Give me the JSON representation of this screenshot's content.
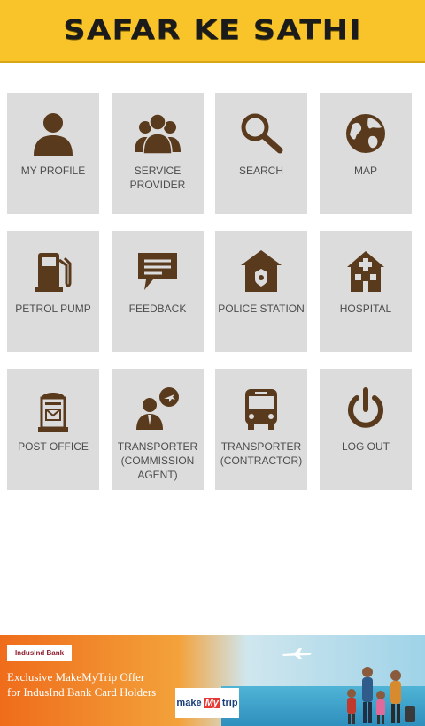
{
  "header": {
    "title": "SAFAR KE SATHI"
  },
  "colors": {
    "header_bg": "#f9c32a",
    "tile_bg": "#dcdcdc",
    "icon": "#5a3a1c",
    "label": "#4d4d4d"
  },
  "menu": [
    {
      "label": "MY PROFILE",
      "icon": "person-icon"
    },
    {
      "label": "SERVICE PROVIDER",
      "icon": "group-icon"
    },
    {
      "label": "SEARCH",
      "icon": "search-icon"
    },
    {
      "label": "MAP",
      "icon": "globe-icon"
    },
    {
      "label": "PETROL PUMP",
      "icon": "fuel-pump-icon"
    },
    {
      "label": "FEEDBACK",
      "icon": "chat-bubble-icon"
    },
    {
      "label": "POLICE STATION",
      "icon": "police-badge-icon"
    },
    {
      "label": "HOSPITAL",
      "icon": "hospital-icon"
    },
    {
      "label": "POST OFFICE",
      "icon": "postbox-icon"
    },
    {
      "label": "TRANSPORTER\n(COMMISSION\nAGENT)",
      "icon": "agent-plane-icon"
    },
    {
      "label": "TRANSPORTER\n(CONTRACTOR)",
      "icon": "bus-icon"
    },
    {
      "label": "LOG OUT",
      "icon": "power-icon"
    }
  ],
  "ad": {
    "bank": "IndusInd Bank",
    "line1": "Exclusive MakeMyTrip Offer",
    "line2": "for IndusInd Bank Card Holders",
    "brand_make": "make",
    "brand_my": "My",
    "brand_trip": "trip"
  }
}
